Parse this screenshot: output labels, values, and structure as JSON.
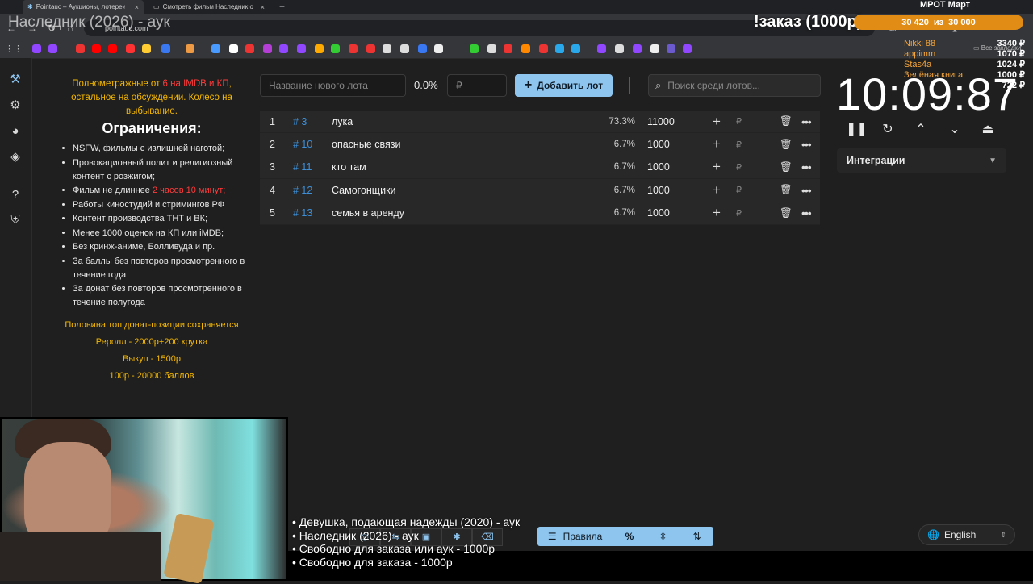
{
  "browser": {
    "tabs": [
      {
        "label": "Pointauc – Аукционы, лотереи",
        "active": true
      },
      {
        "label": "Смотреть фильм Наследник о",
        "active": false
      }
    ],
    "url": "pointauc.com",
    "bookmarks_folder": "Все закладки"
  },
  "stream": {
    "title_overlay": "Наследник (2026) - аук",
    "order_label": "!заказ (1000р)",
    "mrot_label": "МРОТ Март",
    "goal_current": "30 420",
    "goal_sep": "из",
    "goal_target": "30 000",
    "donors": [
      {
        "name": "Nikki 88",
        "amount": "3340 ₽"
      },
      {
        "name": "appimm",
        "amount": "1070 ₽"
      },
      {
        "name": "Stas4a",
        "amount": "1024 ₽"
      },
      {
        "name": "Зелёная книга",
        "amount": "1000 ₽"
      },
      {
        "name": "",
        "amount": "722 ₽"
      }
    ],
    "queue": [
      "• Девушка, подающая надежды (2020) - аук",
      "• Наследник (2026) - аук",
      "• Свободно для заказа или аук - 1000р",
      "• Свободно для заказа - 1000р"
    ]
  },
  "rules": {
    "intro_a": "Полнометражные от ",
    "intro_red": "6 на IMDB и КП",
    "intro_b": ", остальное на обсуждении. Колесо на выбывание.",
    "heading": "Ограничения:",
    "items": [
      "NSFW, фильмы с излишней наготой;",
      "Провокационный полит и религиозный контент с розжигом;",
      "Фильм не длиннее ",
      "Работы киностудий и стримингов РФ",
      "Контент производства ТНТ и ВК;",
      "Менее 1000 оценок на КП или iMDB;",
      "Без кринж-аниме, Болливуда и пр.",
      "За баллы без повторов просмотренного в течение года",
      "За донат без повторов просмотренного в течение полугода"
    ],
    "duration_red": "2 часов 10 минут;",
    "bottom": [
      "Половина топ донат-позиции сохраняется",
      "Реролл - 2000р+200 крутка",
      "Выкуп - 1500р",
      "100р - 20000 баллов"
    ]
  },
  "toolbar": {
    "lot_placeholder": "Название нового лота",
    "percent": "0.0%",
    "rub_placeholder": "₽",
    "add_label": "Добавить лот",
    "search_placeholder": "Поиск среди лотов..."
  },
  "lots": [
    {
      "index": "1",
      "id": "# 3",
      "name": "лука",
      "percent": "73.3%",
      "amount": "11000"
    },
    {
      "index": "2",
      "id": "# 10",
      "name": "опасные связи",
      "percent": "6.7%",
      "amount": "1000"
    },
    {
      "index": "3",
      "id": "# 11",
      "name": "кто там",
      "percent": "6.7%",
      "amount": "1000"
    },
    {
      "index": "4",
      "id": "# 12",
      "name": "Самогонщики",
      "percent": "6.7%",
      "amount": "1000"
    },
    {
      "index": "5",
      "id": "# 13",
      "name": "семья в аренду",
      "percent": "6.7%",
      "amount": "1000"
    }
  ],
  "lot_currency": "₽",
  "timer": {
    "value": "10:09:87"
  },
  "integrations": {
    "label": "Интеграции"
  },
  "actionbar": {
    "rules_label": "Правила"
  },
  "language": {
    "selected": "English"
  },
  "colors": {
    "accent": "#8ec5ef",
    "rules_yellow": "#f5b800",
    "rules_red": "#ff3b3b",
    "id_blue": "#3d8fd8",
    "goal_orange": "#e08c15"
  }
}
